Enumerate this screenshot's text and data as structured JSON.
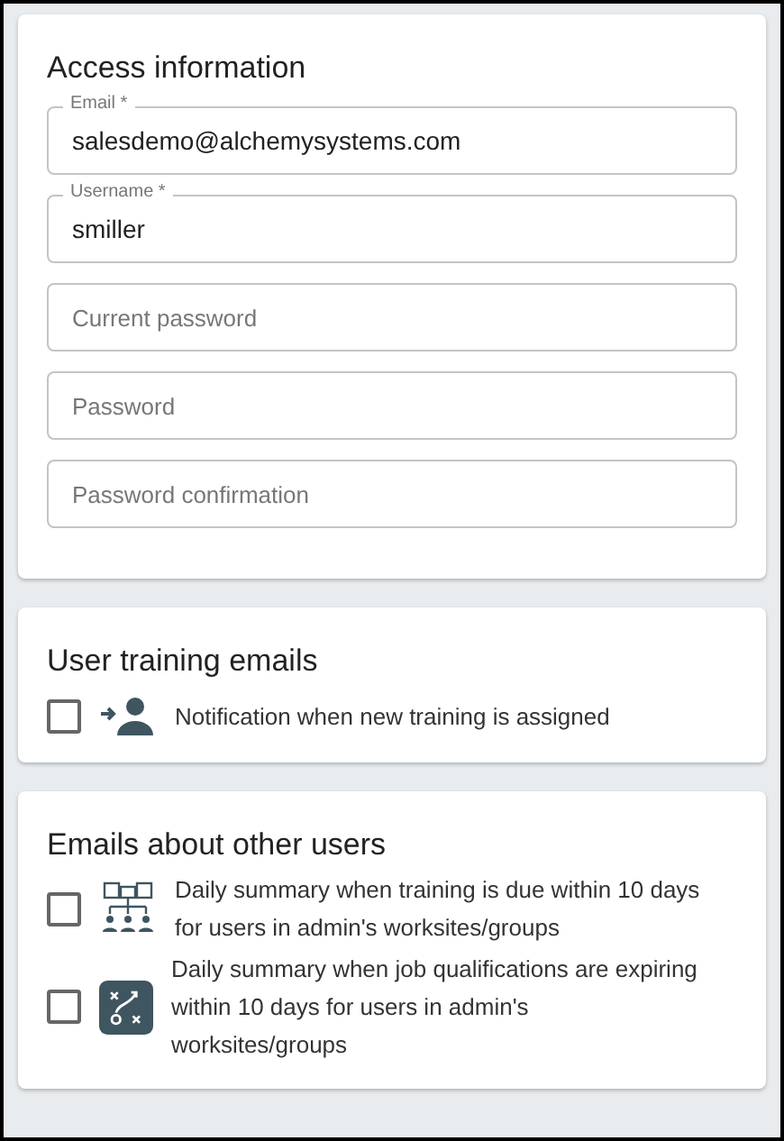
{
  "access": {
    "title": "Access information",
    "fields": [
      {
        "label": "Email *",
        "value": "salesdemo@alchemysystems.com"
      },
      {
        "label": "Username *",
        "value": "smiller"
      },
      {
        "placeholder": "Current password"
      },
      {
        "placeholder": "Password"
      },
      {
        "placeholder": "Password confirmation"
      }
    ]
  },
  "user_training": {
    "title": "User training emails",
    "options": [
      {
        "kind": "person-arrow",
        "label": "Notification when new training is assigned",
        "checked": false
      }
    ]
  },
  "other_users": {
    "title": "Emails about other users",
    "options": [
      {
        "kind": "org-chart",
        "label": "Daily summary when training is due within 10 days for users in admin's worksites/groups",
        "checked": false
      },
      {
        "kind": "strategy",
        "label": "Daily summary when job qualifications are expiring within 10 days for users in admin's worksites/groups",
        "checked": false
      }
    ]
  }
}
